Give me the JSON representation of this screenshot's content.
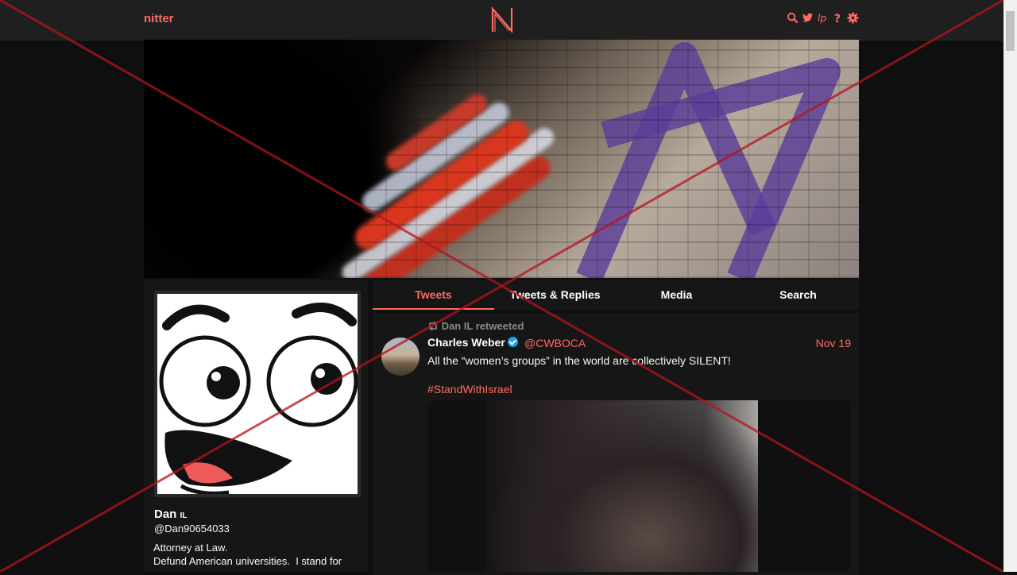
{
  "nav": {
    "brand": "nitter",
    "logo_letter": "N",
    "icons": [
      "search-icon",
      "twitter-icon",
      "rss-icon",
      "help-icon",
      "settings-icon"
    ]
  },
  "profile": {
    "name": "Dan",
    "name_badge": "IL",
    "handle": "@Dan90654033",
    "bio_line1": "Attorney at Law.",
    "bio_line2": "Defund American universities.  I stand for"
  },
  "tabs": [
    {
      "label": "Tweets",
      "active": true
    },
    {
      "label": "Tweets & Replies",
      "active": false
    },
    {
      "label": "Media",
      "active": false
    },
    {
      "label": "Search",
      "active": false
    }
  ],
  "tweet": {
    "retweet_label": "Dan IL retweeted",
    "author_name": "Charles Weber",
    "author_handle": "@CWBOCA",
    "date": "Nov 19",
    "text": "All the “women’s groups” in the world are collectively SILENT!",
    "hashtag": "#StandWithIsrael"
  },
  "colors": {
    "accent": "#ff6c60",
    "background": "#0f0f0f",
    "panel": "#161616",
    "navbar": "#1f1f1f",
    "verified": "#1da1f2",
    "cross": "#b4141e"
  }
}
